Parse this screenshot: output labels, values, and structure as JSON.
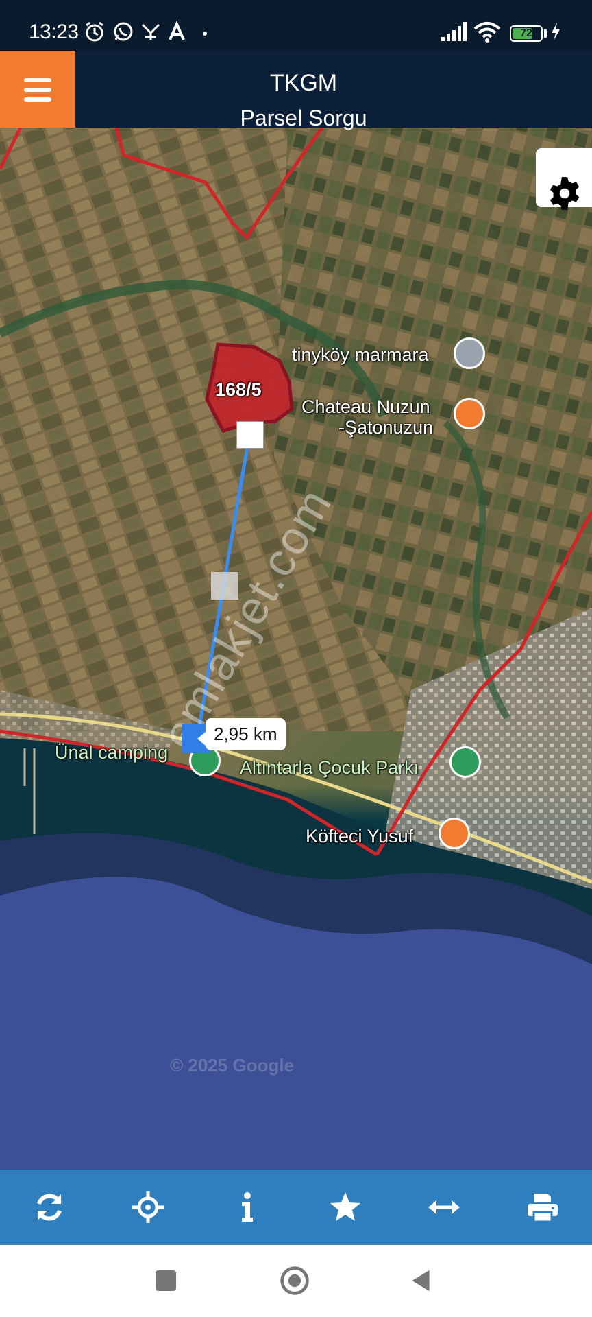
{
  "status": {
    "time": "13:23",
    "battery": "72",
    "battery_level": 0.72
  },
  "header": {
    "title": "TKGM",
    "subtitle": "Parsel Sorgu"
  },
  "map": {
    "parcel_label": "168/5",
    "distance": "2,95 km",
    "watermark": "emlakjet.com",
    "copyright": "© 2025 Google",
    "pois": [
      {
        "label": "tinyköy marmara",
        "icon": "place-pin-icon",
        "color": "#9aa3ad"
      },
      {
        "label": "Chateau Nuzun",
        "label2": "-Şatonuzun",
        "icon": "wine-glass-icon",
        "color": "#f07b31"
      },
      {
        "label": "Ünal camping",
        "icon": "camping-pin-icon",
        "color": "#2e9c5a"
      },
      {
        "label": "Altıntarla Çocuk Parkı",
        "icon": "tree-icon",
        "color": "#2e9c5a"
      },
      {
        "label": "Köfteci Yusuf",
        "icon": "restaurant-icon",
        "color": "#f07b31"
      }
    ]
  },
  "toolbar": {
    "items": [
      "refresh-icon",
      "locate-icon",
      "info-icon",
      "favorite-star-icon",
      "measure-icon",
      "print-icon"
    ]
  },
  "colors": {
    "header_bg": "#0b1f38",
    "menu_accent": "#f07b31",
    "toolbar_bg": "#2f7fbe",
    "parcel_fill": "#c0272d",
    "boundary": "#d0262a",
    "measure_line": "#3b8cf0"
  }
}
